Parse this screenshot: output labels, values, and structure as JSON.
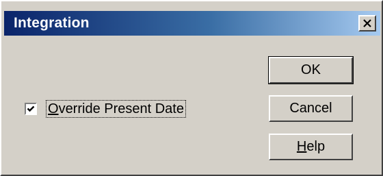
{
  "window": {
    "title": "Integration",
    "close_label": "×"
  },
  "options": {
    "override_present_date": {
      "label_mnemonic": "O",
      "label_rest": "verride Present Date",
      "checked": true
    }
  },
  "buttons": {
    "ok_label": "OK",
    "cancel_label": "Cancel",
    "help_mnemonic": "H",
    "help_rest": "elp"
  },
  "colors": {
    "face": "#d4d0c8",
    "title_start": "#0a246a",
    "title_end": "#a6caf0"
  },
  "icons": {
    "close": "close-icon",
    "check": "checkmark-icon"
  }
}
